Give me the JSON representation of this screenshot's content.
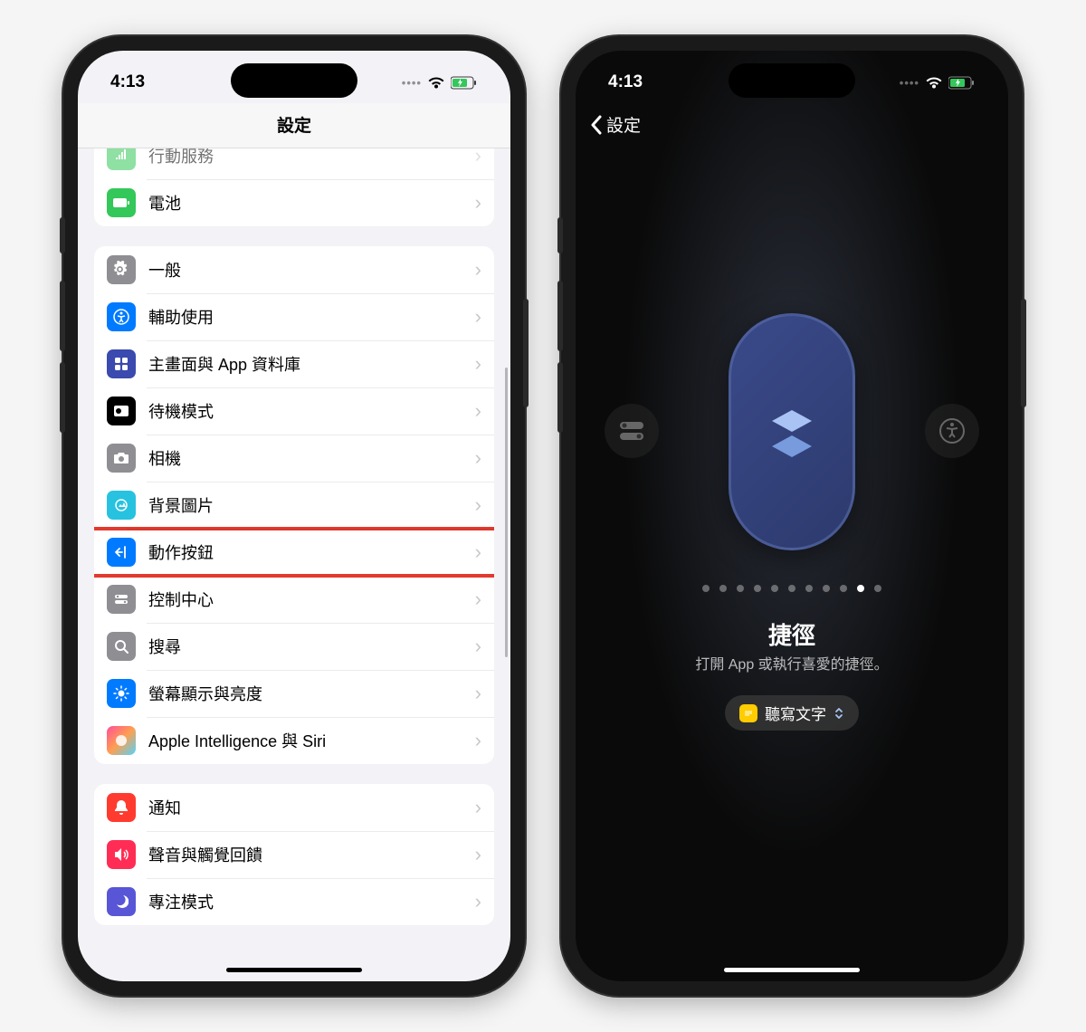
{
  "status": {
    "time": "4:13"
  },
  "left": {
    "title": "設定",
    "group1": [
      {
        "label": "行動服務",
        "color": "#34c759",
        "iconKey": "cellular"
      },
      {
        "label": "電池",
        "color": "#34c759",
        "iconKey": "battery"
      }
    ],
    "group2": [
      {
        "label": "一般",
        "color": "#8e8e93",
        "iconKey": "gear"
      },
      {
        "label": "輔助使用",
        "color": "#007aff",
        "iconKey": "accessibility"
      },
      {
        "label": "主畫面與 App 資料庫",
        "color": "#3a4aaf",
        "iconKey": "apps"
      },
      {
        "label": "待機模式",
        "color": "#000000",
        "iconKey": "standby"
      },
      {
        "label": "相機",
        "color": "#8e8e93",
        "iconKey": "camera"
      },
      {
        "label": "背景圖片",
        "color": "#27c2e0",
        "iconKey": "wallpaper"
      },
      {
        "label": "動作按鈕",
        "color": "#007aff",
        "iconKey": "action",
        "highlight": true
      },
      {
        "label": "控制中心",
        "color": "#8e8e93",
        "iconKey": "control"
      },
      {
        "label": "搜尋",
        "color": "#8e8e93",
        "iconKey": "search"
      },
      {
        "label": "螢幕顯示與亮度",
        "color": "#007aff",
        "iconKey": "brightness"
      },
      {
        "label": "Apple Intelligence 與 Siri",
        "color": "#ff4f9b",
        "iconKey": "siri"
      }
    ],
    "group3": [
      {
        "label": "通知",
        "color": "#ff3b30",
        "iconKey": "bell"
      },
      {
        "label": "聲音與觸覺回饋",
        "color": "#ff2d55",
        "iconKey": "sound"
      },
      {
        "label": "專注模式",
        "color": "#5856d6",
        "iconKey": "focus"
      }
    ]
  },
  "right": {
    "back": "設定",
    "title": "捷徑",
    "desc": "打開 App 或執行喜愛的捷徑。",
    "shortcut": "聽寫文字",
    "pagerCount": 11,
    "pagerActive": 9
  }
}
